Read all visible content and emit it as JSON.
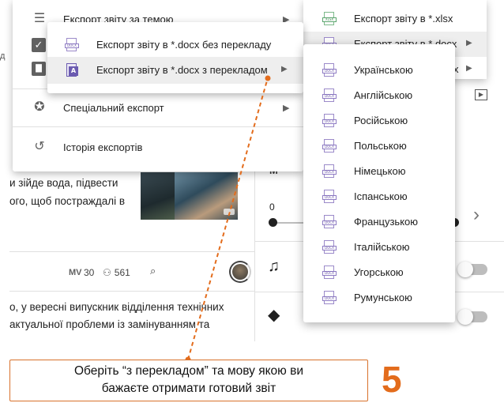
{
  "main_menu": {
    "item_theme": "Експорт звіту за темою",
    "item_special": "Спеціальний експорт",
    "item_history": "Історія експортів"
  },
  "docx_submenu": {
    "no_translation": "Експорт звіту в *.docx без перекладу",
    "with_translation": "Експорт звіту в *.docx з перекладом"
  },
  "export_menu": {
    "xlsx": "Експорт звіту в *.xlsx",
    "docx": "Експорт звіту в *.docx",
    "tail": "x"
  },
  "languages": [
    "Українською",
    "Англійською",
    "Російською",
    "Польською",
    "Німецькою",
    "Іспанською",
    "Французькою",
    "Італійською",
    "Угорською",
    "Румунською"
  ],
  "background": {
    "frag_a": "д",
    "article_text_1": "и зійде вода, підвести\nого, щоб постраждалі в",
    "stat_mv_label": "MV",
    "stat_mv_value": "30",
    "stat_people_value": "561",
    "article_text_2": "о, у вересні випускник відділення технічних\nактуальної проблеми із замінуванням та",
    "slider_start": "0",
    "right_m": "M"
  },
  "callout": {
    "text_line1": "Оберіть “з перекладом” та мову якою ви",
    "text_line2": "бажаєте отримати готовий звіт",
    "step": "5"
  },
  "colors": {
    "accent": "#e36c1c",
    "callout_border": "#d8712b",
    "docx_icon": "#8f7cc4",
    "xlsx_icon": "#5aa56d"
  }
}
